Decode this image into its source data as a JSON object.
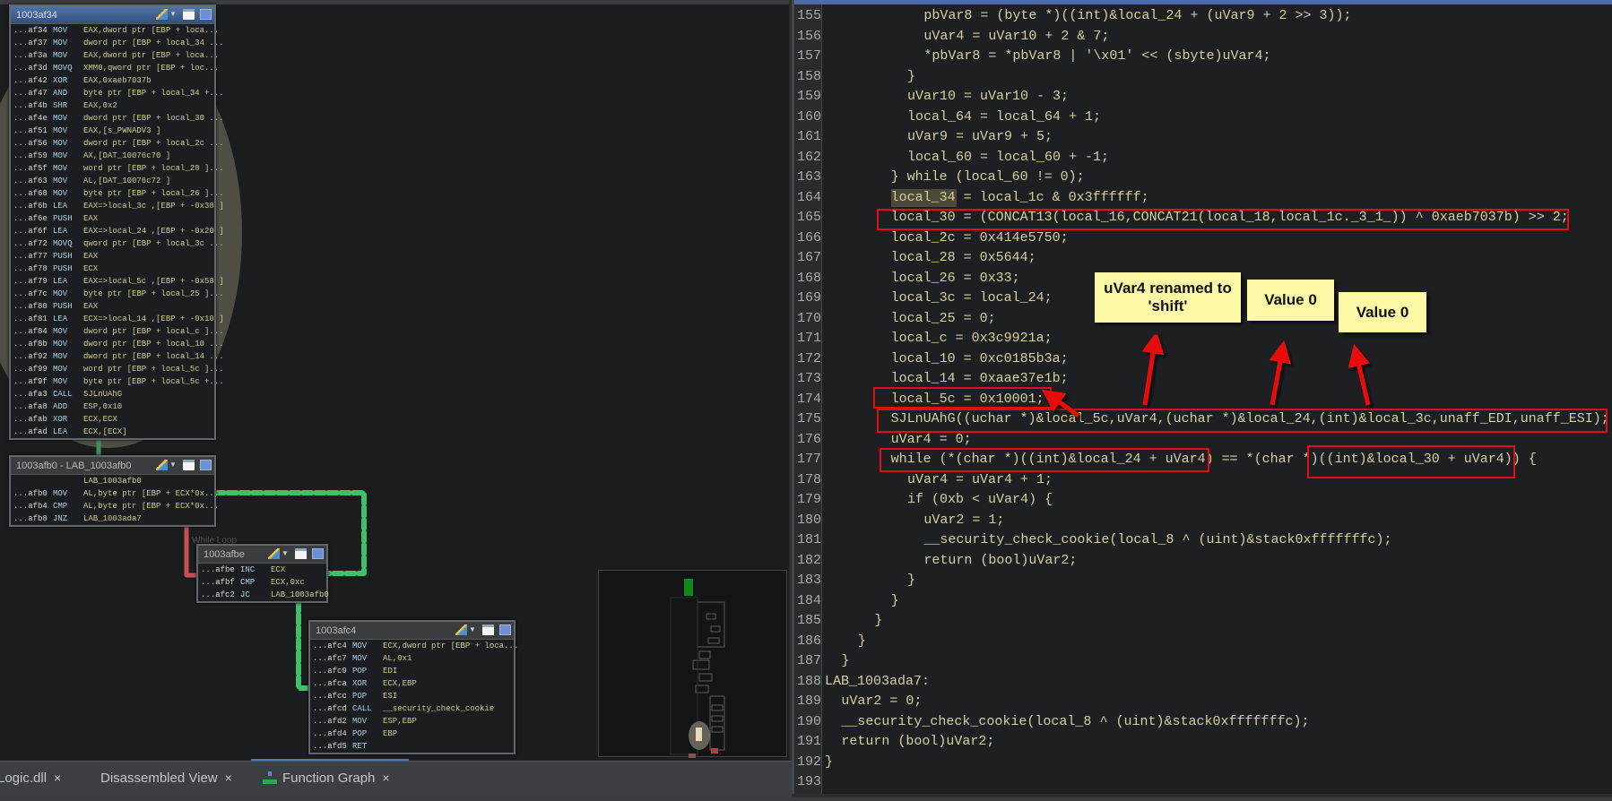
{
  "graph": {
    "edge_label": "While Loop",
    "blocks": [
      {
        "title": "1003af34",
        "rows": [
          {
            "a": "...af34",
            "m": "MOV",
            "o": "EAX,dword ptr [EBP + loca..."
          },
          {
            "a": "...af37",
            "m": "MOV",
            "o": "dword ptr [EBP + local_34 ..."
          },
          {
            "a": "...af3a",
            "m": "MOV",
            "o": "EAX,dword ptr [EBP + loca..."
          },
          {
            "a": "...af3d",
            "m": "MOVQ",
            "o": "XMM0,qword ptr [EBP + loc..."
          },
          {
            "a": "...af42",
            "m": "XOR",
            "o": "EAX,0xaeb7037b"
          },
          {
            "a": "...af47",
            "m": "AND",
            "o": "byte ptr [EBP + local_34 +..."
          },
          {
            "a": "...af4b",
            "m": "SHR",
            "o": "EAX,0x2"
          },
          {
            "a": "...af4e",
            "m": "MOV",
            "o": "dword ptr [EBP + local_30 ..."
          },
          {
            "a": "...af51",
            "m": "MOV",
            "o": "EAX,[s_PWNADV3 ]"
          },
          {
            "a": "...af56",
            "m": "MOV",
            "o": "dword ptr [EBP + local_2c ..."
          },
          {
            "a": "...af59",
            "m": "MOV",
            "o": "AX,[DAT_10076c70 ]"
          },
          {
            "a": "...af5f",
            "m": "MOV",
            "o": "word ptr [EBP + local_28 ]..."
          },
          {
            "a": "...af63",
            "m": "MOV",
            "o": "AL,[DAT_10076c72 ]"
          },
          {
            "a": "...af68",
            "m": "MOV",
            "o": "byte ptr [EBP + local_26 ]..."
          },
          {
            "a": "...af6b",
            "m": "LEA",
            "o": "EAX=>local_3c ,[EBP + -0x38 ]"
          },
          {
            "a": "...af6e",
            "m": "PUSH",
            "o": "EAX"
          },
          {
            "a": "...af6f",
            "m": "LEA",
            "o": "EAX=>local_24 ,[EBP + -0x20 ]"
          },
          {
            "a": "...af72",
            "m": "MOVQ",
            "o": "qword ptr [EBP + local_3c ..."
          },
          {
            "a": "...af77",
            "m": "PUSH",
            "o": "EAX"
          },
          {
            "a": "...af78",
            "m": "PUSH",
            "o": "ECX"
          },
          {
            "a": "...af79",
            "m": "LEA",
            "o": "EAX=>local_5c ,[EBP + -0x58 ]"
          },
          {
            "a": "...af7c",
            "m": "MOV",
            "o": "byte ptr [EBP + local_25 ]..."
          },
          {
            "a": "...af80",
            "m": "PUSH",
            "o": "EAX"
          },
          {
            "a": "...af81",
            "m": "LEA",
            "o": "ECX=>local_14 ,[EBP + -0x10 ]"
          },
          {
            "a": "...af84",
            "m": "MOV",
            "o": "dword ptr [EBP + local_c ]..."
          },
          {
            "a": "...af8b",
            "m": "MOV",
            "o": "dword ptr [EBP + local_10 ..."
          },
          {
            "a": "...af92",
            "m": "MOV",
            "o": "dword ptr [EBP + local_14 ..."
          },
          {
            "a": "...af99",
            "m": "MOV",
            "o": "word ptr [EBP + local_5c ]..."
          },
          {
            "a": "...af9f",
            "m": "MOV",
            "o": "byte ptr [EBP + local_5c +..."
          },
          {
            "a": "...afa3",
            "m": "CALL",
            "o": "SJLnUAhG"
          },
          {
            "a": "...afa8",
            "m": "ADD",
            "o": "ESP,0x10"
          },
          {
            "a": "...afab",
            "m": "XOR",
            "o": "ECX,ECX"
          },
          {
            "a": "...afad",
            "m": "LEA",
            "o": "ECX,[ECX]"
          }
        ]
      },
      {
        "title": "1003afb0 - LAB_1003afb0",
        "rows": [
          {
            "a": "",
            "m": "",
            "o": "LAB_1003afb0"
          },
          {
            "a": "...afb0",
            "m": "MOV",
            "o": "AL,byte ptr [EBP + ECX*0x..."
          },
          {
            "a": "...afb4",
            "m": "CMP",
            "o": "AL,byte ptr [EBP + ECX*0x..."
          },
          {
            "a": "...afb8",
            "m": "JNZ",
            "o": "LAB_1003ada7"
          }
        ]
      },
      {
        "title": "1003afbe",
        "rows": [
          {
            "a": "...afbe",
            "m": "INC",
            "o": "ECX"
          },
          {
            "a": "...afbf",
            "m": "CMP",
            "o": "ECX,0xc"
          },
          {
            "a": "...afc2",
            "m": "JC",
            "o": "LAB_1003afb0"
          }
        ]
      },
      {
        "title": "1003afc4",
        "rows": [
          {
            "a": "...afc4",
            "m": "MOV",
            "o": "ECX,dword ptr [EBP + loca..."
          },
          {
            "a": "...afc7",
            "m": "MOV",
            "o": "AL,0x1"
          },
          {
            "a": "...afc9",
            "m": "POP",
            "o": "EDI"
          },
          {
            "a": "...afca",
            "m": "XOR",
            "o": "ECX,EBP"
          },
          {
            "a": "...afcc",
            "m": "POP",
            "o": "ESI"
          },
          {
            "a": "...afcd",
            "m": "CALL",
            "o": "__security_check_cookie"
          },
          {
            "a": "...afd2",
            "m": "MOV",
            "o": "ESP,EBP"
          },
          {
            "a": "...afd4",
            "m": "POP",
            "o": "EBP"
          },
          {
            "a": "...afd5",
            "m": "RET",
            "o": ""
          }
        ]
      }
    ]
  },
  "code": {
    "lines": [
      {
        "n": "155",
        "i": 12,
        "t": "pbVar8 = (byte *)((int)&local_24 + (uVar9 + 2 >> 3));"
      },
      {
        "n": "156",
        "i": 12,
        "t": "uVar4 = uVar10 + 2 & 7;"
      },
      {
        "n": "157",
        "i": 12,
        "t": "*pbVar8 = *pbVar8 | '\\x01' << (sbyte)uVar4;"
      },
      {
        "n": "158",
        "i": 10,
        "t": "}"
      },
      {
        "n": "159",
        "i": 10,
        "t": "uVar10 = uVar10 - 3;"
      },
      {
        "n": "160",
        "i": 10,
        "t": "local_64 = local_64 + 1;"
      },
      {
        "n": "161",
        "i": 10,
        "t": "uVar9 = uVar9 + 5;"
      },
      {
        "n": "162",
        "i": 10,
        "t": "local_60 = local_60 + -1;"
      },
      {
        "n": "163",
        "i": 8,
        "t": "} while (local_60 != 0);"
      },
      {
        "n": "164",
        "i": 8,
        "t": "local_34 = local_1c & 0x3ffffff;",
        "highlight": "local_34"
      },
      {
        "n": "165",
        "i": 8,
        "t": "local_30 = (CONCAT13(local_16,CONCAT21(local_18,local_1c._3_1_)) ^ 0xaeb7037b) >> 2;"
      },
      {
        "n": "166",
        "i": 8,
        "t": "local_2c = 0x414e5750;"
      },
      {
        "n": "167",
        "i": 8,
        "t": "local_28 = 0x5644;"
      },
      {
        "n": "168",
        "i": 8,
        "t": "local_26 = 0x33;"
      },
      {
        "n": "169",
        "i": 8,
        "t": "local_3c = local_24;"
      },
      {
        "n": "170",
        "i": 8,
        "t": "local_25 = 0;"
      },
      {
        "n": "171",
        "i": 8,
        "t": "local_c = 0x3c9921a;"
      },
      {
        "n": "172",
        "i": 8,
        "t": "local_10 = 0xc0185b3a;"
      },
      {
        "n": "173",
        "i": 8,
        "t": "local_14 = 0xaae37e1b;"
      },
      {
        "n": "174",
        "i": 8,
        "t": "local_5c = 0x10001;"
      },
      {
        "n": "175",
        "i": 8,
        "t": "SJLnUAhG((uchar *)&local_5c,uVar4,(uchar *)&local_24,(int)&local_3c,unaff_EDI,unaff_ESI);"
      },
      {
        "n": "176",
        "i": 8,
        "t": "uVar4 = 0;"
      },
      {
        "n": "177",
        "i": 8,
        "t": "while (*(char *)((int)&local_24 + uVar4) == *(char *)((int)&local_30 + uVar4)) {"
      },
      {
        "n": "178",
        "i": 10,
        "t": "uVar4 = uVar4 + 1;"
      },
      {
        "n": "179",
        "i": 10,
        "t": "if (0xb < uVar4) {"
      },
      {
        "n": "180",
        "i": 12,
        "t": "uVar2 = 1;"
      },
      {
        "n": "181",
        "i": 12,
        "t": "__security_check_cookie(local_8 ^ (uint)&stack0xfffffffc);"
      },
      {
        "n": "182",
        "i": 12,
        "t": "return (bool)uVar2;"
      },
      {
        "n": "183",
        "i": 10,
        "t": "}"
      },
      {
        "n": "184",
        "i": 8,
        "t": "}"
      },
      {
        "n": "185",
        "i": 6,
        "t": "}"
      },
      {
        "n": "186",
        "i": 4,
        "t": "}"
      },
      {
        "n": "187",
        "i": 2,
        "t": "}"
      },
      {
        "n": "188",
        "i": 0,
        "t": "LAB_1003ada7:"
      },
      {
        "n": "189",
        "i": 2,
        "t": "uVar2 = 0;"
      },
      {
        "n": "190",
        "i": 2,
        "t": "__security_check_cookie(local_8 ^ (uint)&stack0xfffffffc);"
      },
      {
        "n": "191",
        "i": 2,
        "t": "return (bool)uVar2;"
      },
      {
        "n": "192",
        "i": 0,
        "t": "}"
      },
      {
        "n": "193",
        "i": 0,
        "t": ""
      }
    ]
  },
  "annotations": {
    "callouts": [
      "uVar4 renamed to 'shift'",
      "Value 0",
      "Value 0"
    ],
    "box_color": "#e01010",
    "callout_color": "#fdf8a6"
  },
  "tabs": [
    {
      "label": "Logic.dll",
      "close": "×"
    },
    {
      "label": "Disassembled View",
      "close": "×"
    },
    {
      "label": "Function Graph",
      "close": "×",
      "icon": "function-graph-icon",
      "active": true
    }
  ],
  "colors": {
    "edge_true": "#3fbf68",
    "edge_false": "#d05050",
    "selected_title": "#4a6ea8"
  }
}
